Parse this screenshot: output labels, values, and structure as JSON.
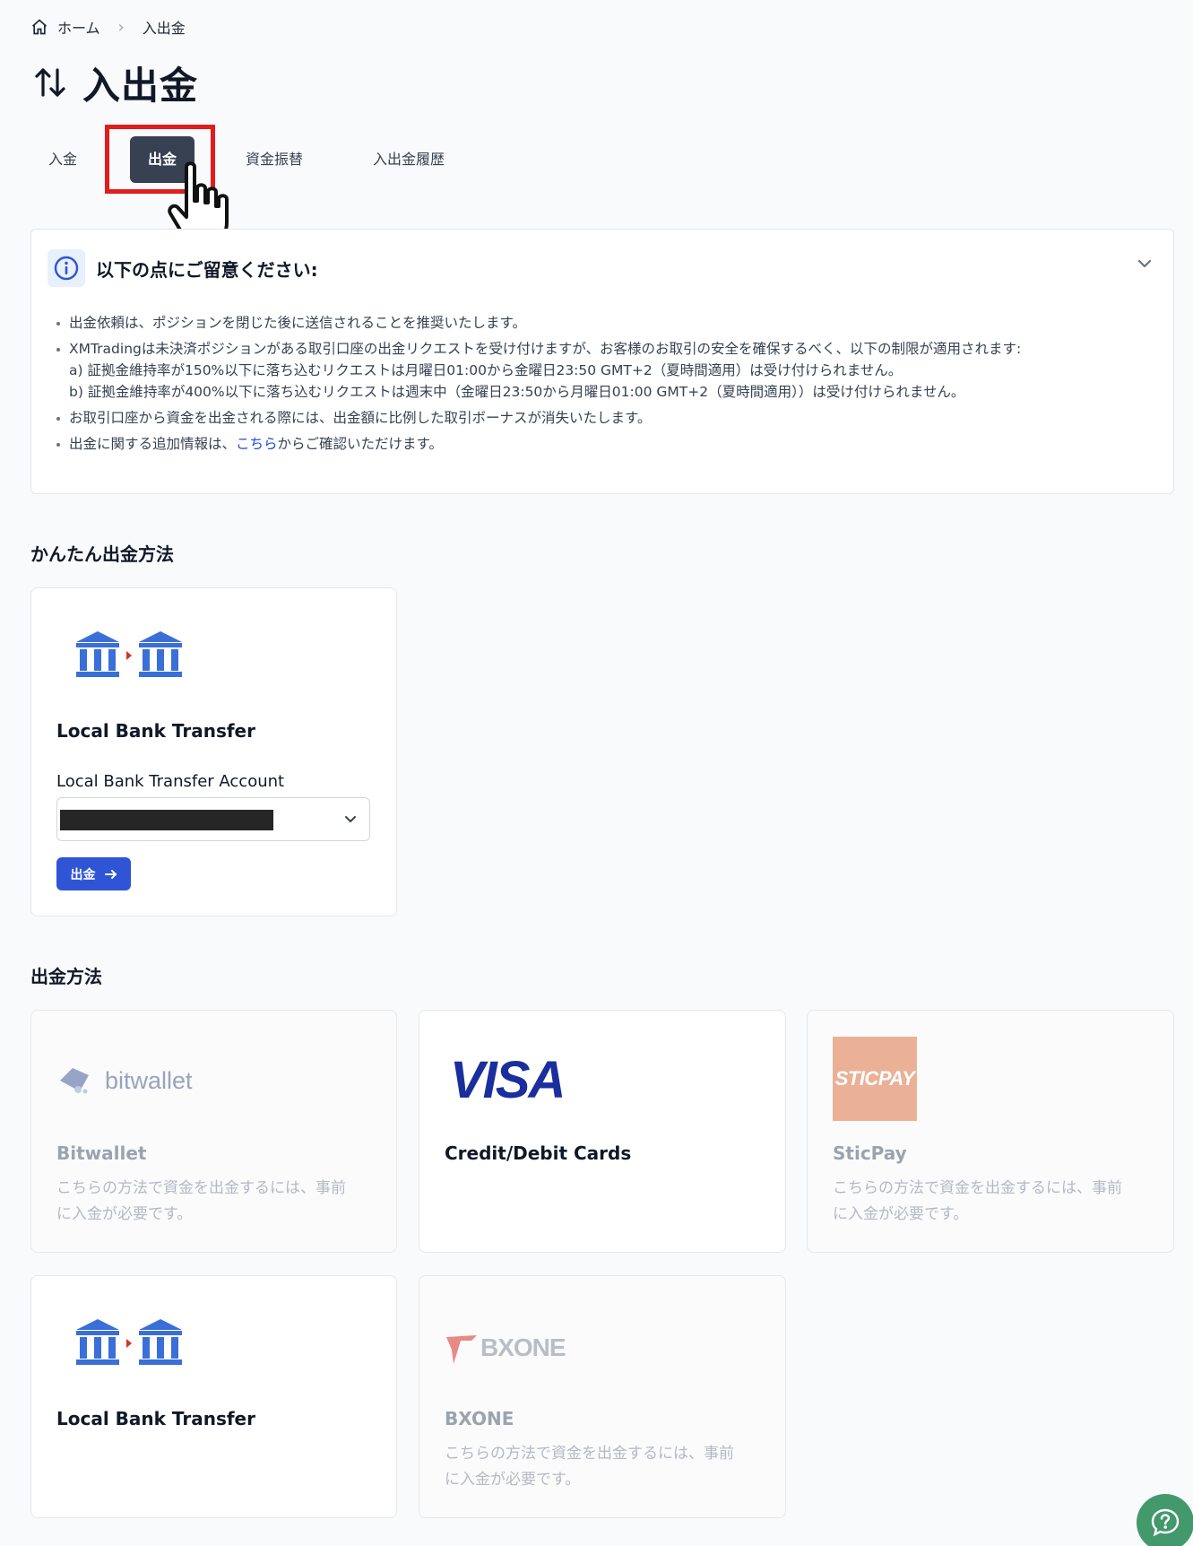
{
  "breadcrumb": {
    "home_label": "ホーム",
    "separator": ">",
    "current": "入出金"
  },
  "page": {
    "title": "入出金",
    "title_icon": "arrows-up-down-icon"
  },
  "tabs": [
    {
      "label": "入金",
      "active": false
    },
    {
      "label": "出金",
      "active": true
    },
    {
      "label": "資金振替",
      "active": false
    },
    {
      "label": "入出金履歴",
      "active": false
    }
  ],
  "notice": {
    "title": "以下の点にご留意ください:",
    "items": [
      {
        "text": "出金依頼は、ポジションを閉じた後に送信されることを推奨いたします。"
      },
      {
        "text": "XMTradingは未決済ポジションがある取引口座の出金リクエストを受け付けますが、お客様のお取引の安全を確保するべく、以下の制限が適用されます:",
        "sub_a": "a) 証拠金維持率が150%以下に落ち込むリクエストは月曜日01:00から金曜日23:50 GMT+2（夏時間適用）は受け付けられません。",
        "sub_b": "b) 証拠金維持率が400%以下に落ち込むリクエストは週末中（金曜日23:50から月曜日01:00 GMT+2（夏時間適用））は受け付けられません。"
      },
      {
        "text": "お取引口座から資金を出金される際には、出金額に比例した取引ボーナスが消失いたします。"
      },
      {
        "text_before": "出金に関する追加情報は、",
        "link": "こちら",
        "text_after": "からご確認いただけます。"
      }
    ]
  },
  "easy_section": {
    "title": "かんたん出金方法",
    "card": {
      "name": "Local Bank Transfer",
      "account_label": "Local Bank Transfer Account",
      "button_label": "出金"
    }
  },
  "methods_section": {
    "title": "出金方法",
    "disabled_note": "こちらの方法で資金を出金するには、事前に入金が必要です。",
    "cards": [
      {
        "name": "Bitwallet",
        "logo_text": "bitwallet"
      },
      {
        "name": "Credit/Debit Cards",
        "logo_text": "VISA"
      },
      {
        "name": "SticPay",
        "logo_text": "STICPAY"
      },
      {
        "name": "Local Bank Transfer"
      },
      {
        "name": "BXONE",
        "logo_text": "BXONE"
      }
    ]
  },
  "colors": {
    "active_tab": "#374151",
    "highlight": "#e11d1d",
    "primary_button": "#2f54d6",
    "bank_icon": "#3b6fd8",
    "help_button": "#43996b"
  }
}
